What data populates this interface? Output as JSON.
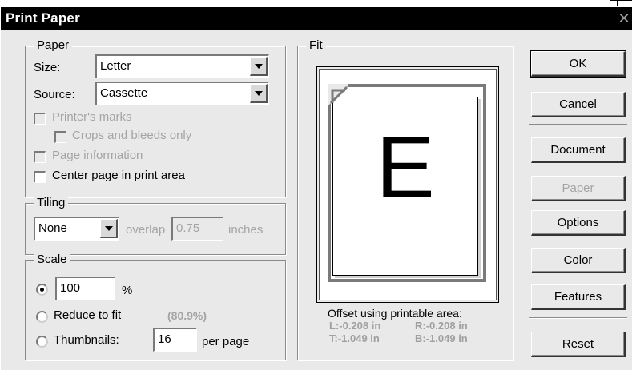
{
  "window": {
    "title": "Print Paper",
    "close_glyph": "✕"
  },
  "paper": {
    "group_label": "Paper",
    "size_label": "Size:",
    "size_value": "Letter",
    "source_label": "Source:",
    "source_value": "Cassette",
    "printers_marks": "Printer's marks",
    "crops_only": "Crops and bleeds only",
    "page_information": "Page information",
    "center_page": "Center page in print area"
  },
  "tiling": {
    "group_label": "Tiling",
    "mode_value": "None",
    "overlap_label": "overlap",
    "overlap_value": "0.75",
    "units": "inches"
  },
  "scale": {
    "group_label": "Scale",
    "percent_value": "100",
    "percent_sign": "%",
    "reduce_label": "Reduce to fit",
    "reduce_pct": "(80.9%)",
    "thumbnails_label": "Thumbnails:",
    "thumbnails_value": "16",
    "per_page": "per page"
  },
  "fit": {
    "group_label": "Fit",
    "preview_letter": "E",
    "offset_heading": "Offset using printable area:",
    "left": "L:-0.208 in",
    "right": "R:-0.208 in",
    "top": "T:-1.049 in",
    "bottom": "B:-1.049 in"
  },
  "buttons": {
    "ok": "OK",
    "cancel": "Cancel",
    "document": "Document",
    "paper": "Paper",
    "options": "Options",
    "color": "Color",
    "features": "Features",
    "reset": "Reset"
  },
  "colors": {
    "titlebar": "#000000",
    "dialog_bg": "#e9e9e9",
    "disabled_text": "#a4a4a4"
  }
}
